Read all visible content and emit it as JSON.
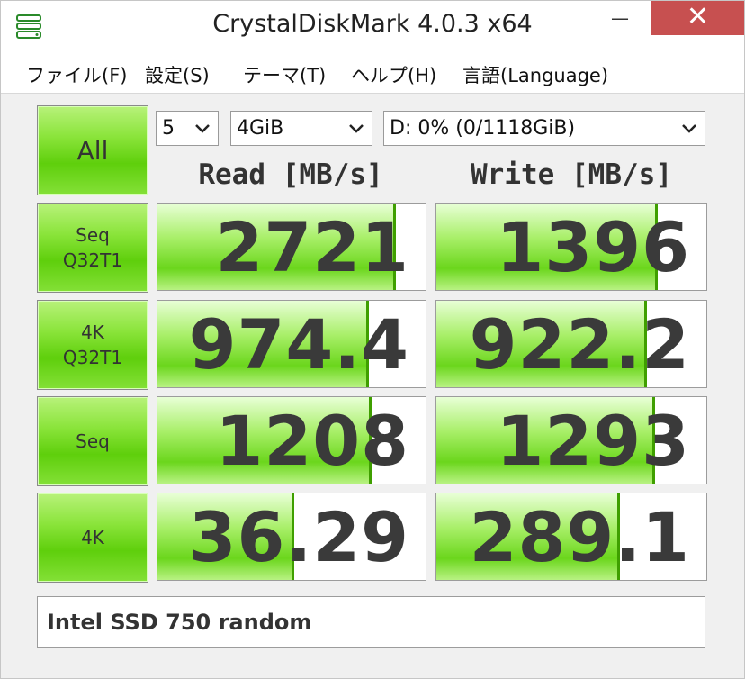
{
  "window": {
    "title": "CrystalDiskMark 4.0.3 x64",
    "min_glyph": "—",
    "max_glyph": "☐",
    "close_glyph": "✕"
  },
  "menu": [
    "ファイル(F)",
    "設定(S)",
    "テーマ(T)",
    "ヘルプ(H)",
    "言語(Language)"
  ],
  "controls": {
    "all_label": "All",
    "count": "5",
    "size": "4GiB",
    "drive": "D: 0% (0/1118GiB)"
  },
  "headers": {
    "read": "Read [MB/s]",
    "write": "Write [MB/s]"
  },
  "tests": [
    {
      "label_line1": "Seq",
      "label_line2": "Q32T1",
      "read": "2721",
      "write": "1396",
      "read_fill": 0.89,
      "write_fill": 0.82
    },
    {
      "label_line1": "4K",
      "label_line2": "Q32T1",
      "read": "974.4",
      "write": "922.2",
      "read_fill": 0.79,
      "write_fill": 0.78
    },
    {
      "label_line1": "Seq",
      "label_line2": "",
      "read": "1208",
      "write": "1293",
      "read_fill": 0.8,
      "write_fill": 0.81
    },
    {
      "label_line1": "4K",
      "label_line2": "",
      "read": "36.29",
      "write": "289.1",
      "read_fill": 0.51,
      "write_fill": 0.68
    }
  ],
  "comment": "Intel SSD 750 random",
  "colors": {
    "accent_green": "#6bd61c",
    "close_red": "#c75050"
  }
}
